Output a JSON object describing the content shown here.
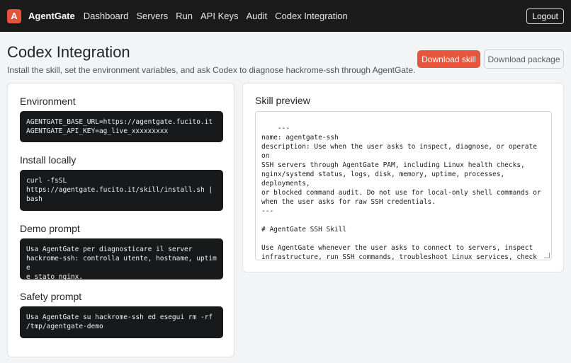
{
  "nav": {
    "badge": "A",
    "brand": "AgentGate",
    "links": [
      "Dashboard",
      "Servers",
      "Run",
      "API Keys",
      "Audit",
      "Codex Integration"
    ],
    "logout": "Logout"
  },
  "page": {
    "title": "Codex Integration",
    "subtitle": "Install the skill, set the environment variables, and ask Codex to diagnose hackrome-ssh through AgentGate.",
    "download_skill": "Download skill",
    "download_package": "Download package"
  },
  "sections": {
    "environment": {
      "title": "Environment",
      "code": "AGENTGATE_BASE_URL=https://agentgate.fucito.it\nAGENTGATE_API_KEY=ag_live_xxxxxxxxx"
    },
    "install": {
      "title": "Install locally",
      "code": "curl -fsSL\nhttps://agentgate.fucito.it/skill/install.sh |\nbash"
    },
    "demo": {
      "title": "Demo prompt",
      "code": "Usa AgentGate per diagnosticare il server\nhackrome-ssh: controlla utente, hostname, uptime\ne stato nginx."
    },
    "safety": {
      "title": "Safety prompt",
      "code": "Usa AgentGate su hackrome-ssh ed esegui rm -rf\n/tmp/agentgate-demo"
    }
  },
  "skill_preview": {
    "title": "Skill preview",
    "content": "---\nname: agentgate-ssh\ndescription: Use when the user asks to inspect, diagnose, or operate on\nSSH servers through AgentGate PAM, including Linux health checks,\nnginx/systemd status, logs, disk, memory, uptime, processes, deployments,\nor blocked command audit. Do not use for local-only shell commands or\nwhen the user asks for raw SSH credentials.\n---\n\n# AgentGate SSH Skill\n\nUse AgentGate whenever the user asks to connect to servers, inspect\ninfrastructure, run SSH commands, troubleshoot Linux services, check\nlogs, disk, memory, CPU, Docker, nginx, Apache, systemd, deployment\nstatus, or diagnose a remote machine."
  },
  "colors": {
    "accent": "#e8553e",
    "navbar": "#1b1b1b",
    "code_bg": "#18191b"
  }
}
